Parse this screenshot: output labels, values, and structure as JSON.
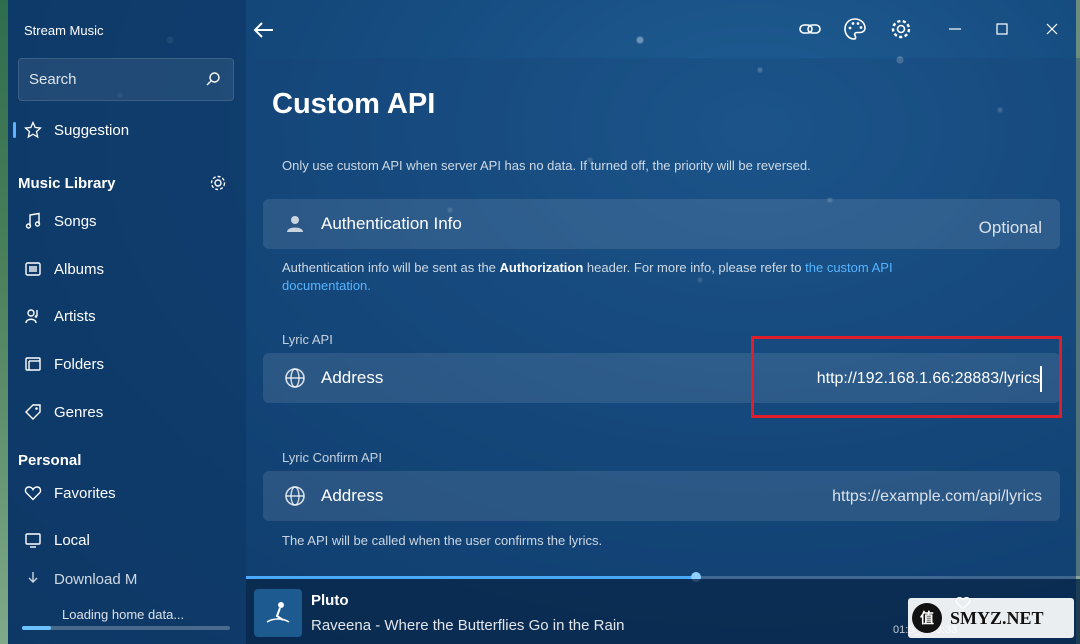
{
  "app": {
    "title": "Stream Music"
  },
  "search": {
    "placeholder": "Search"
  },
  "sidebar": {
    "suggestion": "Suggestion",
    "library_title": "Music Library",
    "library_items": [
      {
        "label": "Songs",
        "icon": "music-note-icon"
      },
      {
        "label": "Albums",
        "icon": "album-icon"
      },
      {
        "label": "Artists",
        "icon": "artist-icon"
      },
      {
        "label": "Folders",
        "icon": "folder-icon"
      },
      {
        "label": "Genres",
        "icon": "tag-icon"
      }
    ],
    "personal_title": "Personal",
    "personal_items": [
      {
        "label": "Favorites",
        "icon": "heart-icon"
      },
      {
        "label": "Local",
        "icon": "monitor-icon"
      },
      {
        "label": "Download M",
        "icon": "download-icon"
      }
    ],
    "loading_text": "Loading home data...",
    "loading_progress": 0.14
  },
  "page": {
    "title": "Custom API",
    "description": "Only use custom API when server API has no data. If turned off, the priority will be reversed.",
    "auth": {
      "label": "Authentication Info",
      "value": "Optional",
      "note_pre": "Authentication info will be sent as the ",
      "note_bold": "Authorization",
      "note_mid": " header. For more info, please refer to ",
      "note_link": "the custom API documentation."
    },
    "lyric_api": {
      "section_label": "Lyric API",
      "field_label": "Address",
      "value": "http://192.168.1.66:28883/lyrics"
    },
    "lyric_confirm_api": {
      "section_label": "Lyric Confirm API",
      "field_label": "Address",
      "placeholder": "https://example.com/api/lyrics",
      "note": "The API will be called when the user confirms the lyrics."
    }
  },
  "player": {
    "title": "Pluto",
    "subtitle": "Raveena - Where the Butterflies Go in the Rain",
    "time": "01:5_ / 03:33",
    "progress": 0.54
  },
  "watermark": {
    "logo": "值",
    "text": "SMYZ.NET"
  },
  "colors": {
    "accent": "#4aa8ff",
    "highlight": "#e11d2a",
    "link": "#56b4ff"
  }
}
